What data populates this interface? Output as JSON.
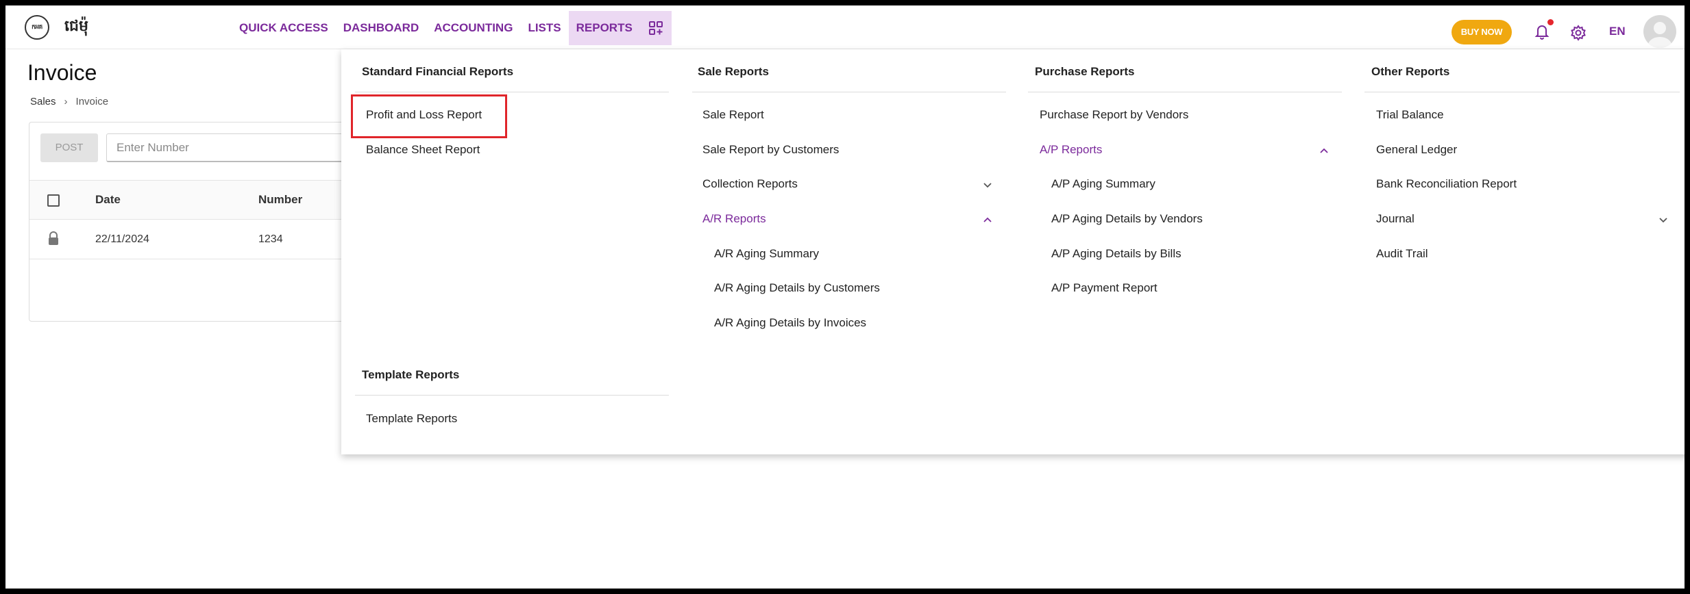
{
  "app": {
    "logo_text": "កអគ",
    "brand": "ជេម៉ុ"
  },
  "nav": {
    "items": [
      "QUICK ACCESS",
      "DASHBOARD",
      "ACCOUNTING",
      "LISTS",
      "REPORTS"
    ],
    "active": "REPORTS",
    "buy_now": "BUY NOW",
    "lang": "EN",
    "accent": "#7b2a9b",
    "buy_now_color": "#f0a810",
    "notification_dot_color": "#e5262d"
  },
  "page": {
    "title": "Invoice",
    "breadcrumb": [
      "Sales",
      "Invoice"
    ],
    "post_label": "POST",
    "number_placeholder": "Enter Number",
    "columns": [
      "Date",
      "Number"
    ],
    "rows": [
      {
        "date": "22/11/2024",
        "number": "1234",
        "locked": true
      }
    ]
  },
  "menu": {
    "standard": {
      "heading": "Standard Financial Reports",
      "items": [
        "Profit and Loss Report",
        "Balance Sheet Report"
      ]
    },
    "template": {
      "heading": "Template Reports",
      "items": [
        "Template Reports"
      ]
    },
    "sale": {
      "heading": "Sale Reports",
      "items": [
        "Sale Report",
        "Sale Report by Customers"
      ],
      "collection": "Collection Reports",
      "ar": "A/R Reports",
      "ar_items": [
        "A/R Aging Summary",
        "A/R Aging Details by Customers",
        "A/R Aging Details by Invoices"
      ]
    },
    "purchase": {
      "heading": "Purchase Reports",
      "items": [
        "Purchase Report by Vendors"
      ],
      "ap": "A/P Reports",
      "ap_items": [
        "A/P Aging Summary",
        "A/P Aging Details by Vendors",
        "A/P Aging Details by Bills",
        "A/P Payment Report"
      ]
    },
    "other": {
      "heading": "Other Reports",
      "items": [
        "Trial Balance",
        "General Ledger",
        "Bank Reconciliation Report"
      ],
      "journal": "Journal",
      "audit": "Audit Trail"
    }
  }
}
